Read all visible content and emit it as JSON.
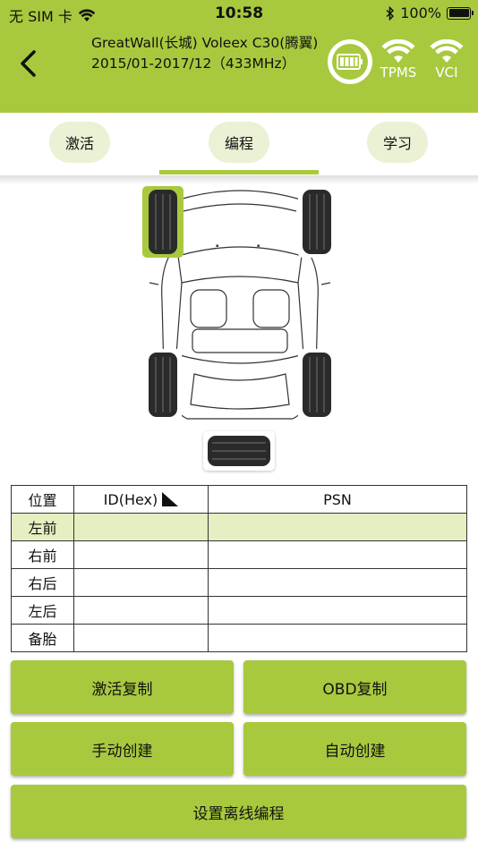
{
  "status_bar": {
    "carrier": "无 SIM 卡",
    "time": "10:58",
    "battery_percent": "100%"
  },
  "header": {
    "title": "GreatWall(长城) Voleex C30(腾翼) 2015/01-2017/12（433MHz）",
    "icons": [
      {
        "name": "obd-battery-icon",
        "label": ""
      },
      {
        "name": "tpms-wifi-icon",
        "label": "TPMS"
      },
      {
        "name": "vci-wifi-icon",
        "label": "VCI"
      }
    ],
    "accent_color": "#a8c93e"
  },
  "tabs": [
    {
      "label": "激活",
      "active": false
    },
    {
      "label": "编程",
      "active": true
    },
    {
      "label": "学习",
      "active": false
    }
  ],
  "wheel_diagram": {
    "selected_wheel": "左前",
    "wheels": [
      "左前",
      "右前",
      "左后",
      "右后",
      "备胎"
    ]
  },
  "table": {
    "headers": [
      "位置",
      "ID(Hex)",
      "PSN"
    ],
    "rows": [
      {
        "pos": "左前",
        "id": "",
        "psn": "",
        "selected": true
      },
      {
        "pos": "右前",
        "id": "",
        "psn": "",
        "selected": false
      },
      {
        "pos": "右后",
        "id": "",
        "psn": "",
        "selected": false
      },
      {
        "pos": "左后",
        "id": "",
        "psn": "",
        "selected": false
      },
      {
        "pos": "备胎",
        "id": "",
        "psn": "",
        "selected": false
      }
    ]
  },
  "buttons": {
    "activate_copy": "激活复制",
    "obd_copy": "OBD复制",
    "manual_create": "手动创建",
    "auto_create": "自动创建",
    "offline_program": "设置离线编程"
  }
}
